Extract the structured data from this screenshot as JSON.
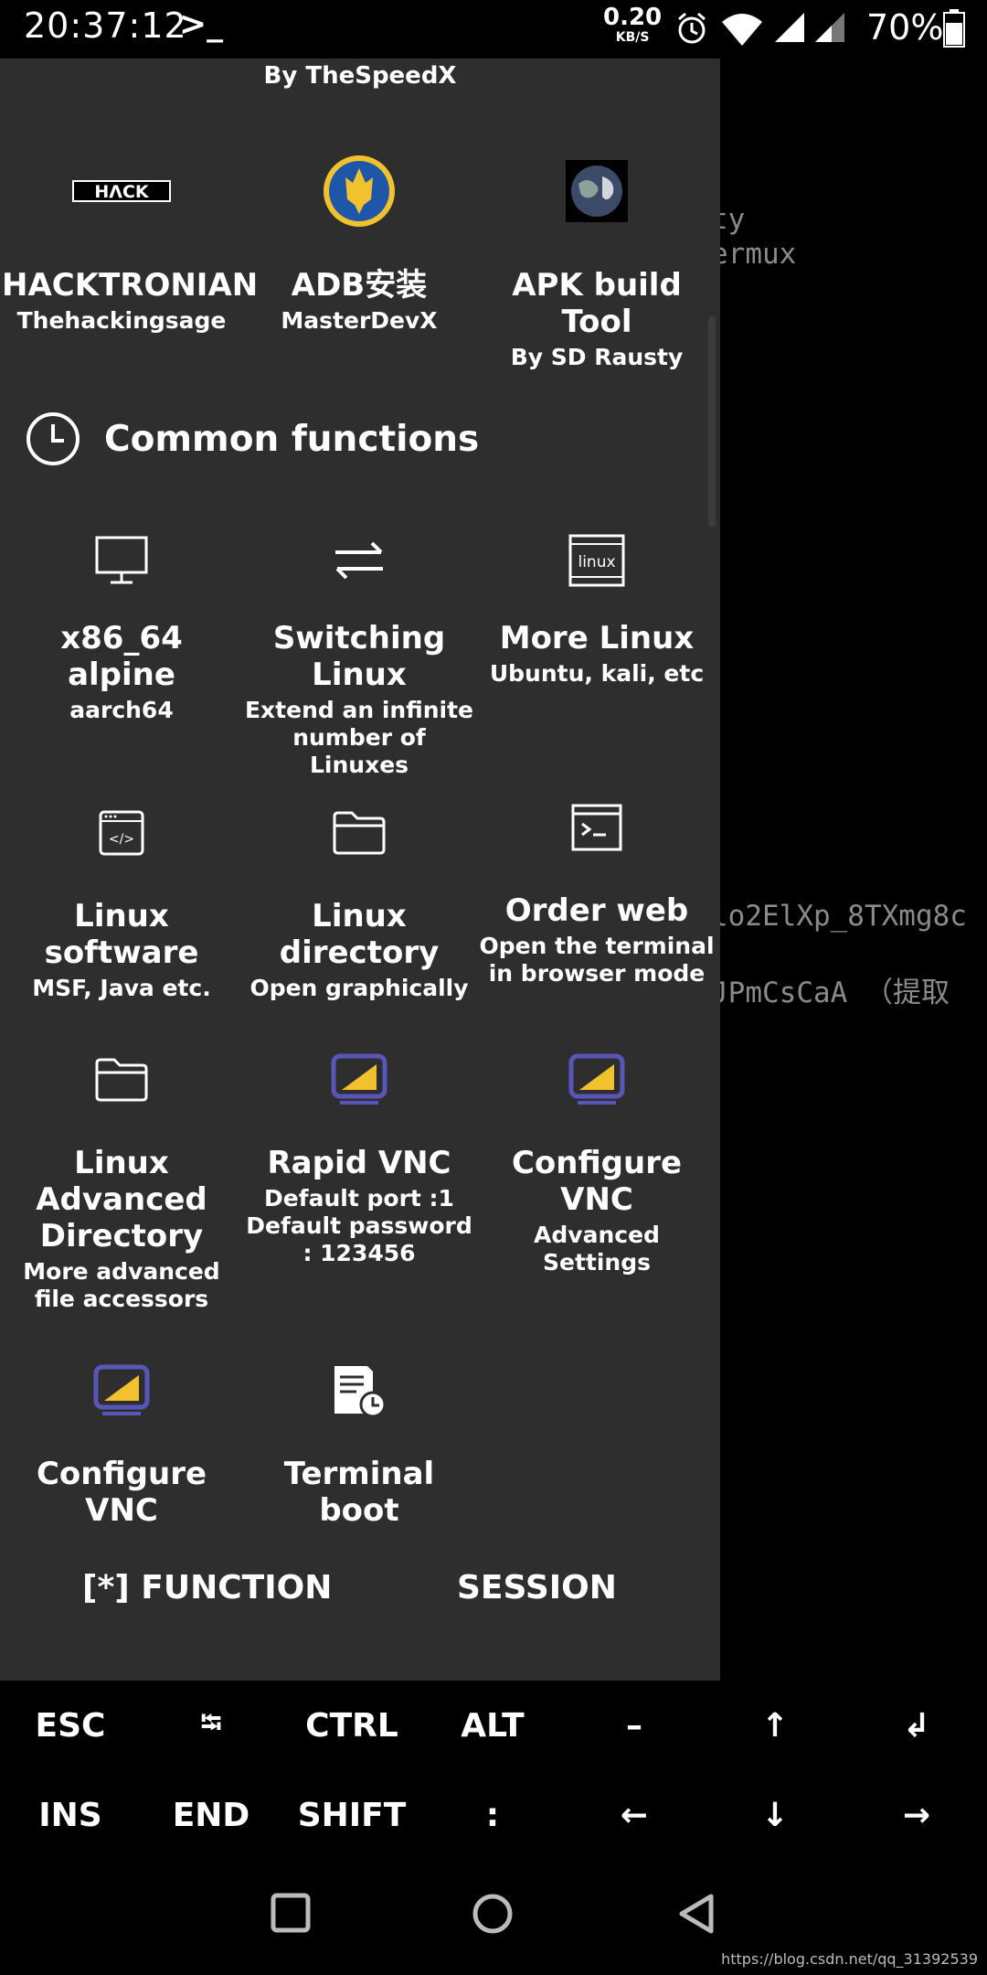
{
  "status_bar": {
    "time": "20:37:12",
    "prompt": ">_",
    "speed_value": "0.20",
    "speed_unit": "KB/S",
    "battery": "70%"
  },
  "terminal": {
    "lines": [
      "ty",
      "ermux",
      "lo2ElXp_8TXmg8c",
      "JPmCsCaA  （提取"
    ]
  },
  "drawer": {
    "top_author": "By TheSpeedX",
    "featured": [
      {
        "title": "HACKTRONIAN",
        "sub": "Thehackingsage",
        "icon": "hack-logo-icon"
      },
      {
        "title": "ADB安装",
        "sub": "MasterDevX",
        "icon": "ukraine-emblem-icon"
      },
      {
        "title": "APK build Tool",
        "sub": "By SD Rausty",
        "icon": "earth-icon"
      }
    ],
    "section_title": "Common functions",
    "section_icon": "clock-icon",
    "functions": [
      {
        "title": "x86_64 alpine",
        "sub": "aarch64",
        "icon": "monitor-icon"
      },
      {
        "title": "Switching Linux",
        "sub": "Extend an infinite number of Linuxes",
        "icon": "swap-arrows-icon"
      },
      {
        "title": "More Linux",
        "sub": "Ubuntu, kali, etc",
        "icon": "linux-box-icon",
        "icon_text": "linux"
      },
      {
        "title": "Linux software",
        "sub": "MSF, Java etc.",
        "icon": "code-window-icon",
        "icon_text": "</>"
      },
      {
        "title": "Linux directory",
        "sub": "Open graphically",
        "icon": "folder-icon"
      },
      {
        "title": "Order web",
        "sub": "Open the terminal in browser mode",
        "icon": "terminal-window-icon"
      },
      {
        "title": "Linux Advanced Directory",
        "sub": "More advanced file accessors",
        "icon": "folder-icon"
      },
      {
        "title": "Rapid VNC",
        "sub": "Default port :1 Default password : 123456",
        "icon": "vnc-monitor-icon"
      },
      {
        "title": "Configure VNC",
        "sub": "Advanced Settings",
        "icon": "vnc-monitor-icon"
      },
      {
        "title": "Configure VNC",
        "sub": "",
        "icon": "vnc-monitor-icon"
      },
      {
        "title": "Terminal boot",
        "sub": "",
        "icon": "document-clock-icon"
      }
    ],
    "tabs": [
      "[*] FUNCTION",
      "SESSION"
    ]
  },
  "extra_keys": {
    "row1": [
      "ESC",
      "⭾",
      "CTRL",
      "ALT",
      "–",
      "↑",
      "↲"
    ],
    "row2": [
      "INS",
      "END",
      "SHIFT",
      ":",
      "←",
      "↓",
      "→"
    ]
  },
  "watermark": "https://blog.csdn.net/qq_31392539",
  "colors": {
    "drawer_bg": "#2e2e2f",
    "vnc_accent": "#5a56b8",
    "vnc_yellow": "#f2c12e"
  }
}
